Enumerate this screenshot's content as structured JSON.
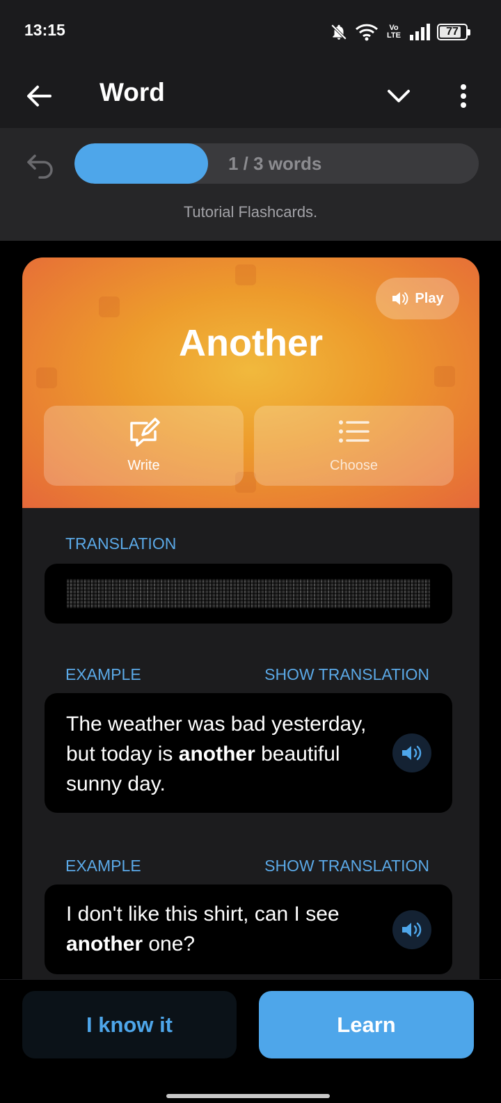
{
  "status": {
    "time": "13:15",
    "network": "Vo LTE",
    "battery": "77"
  },
  "header": {
    "title": "Word"
  },
  "progress": {
    "label": "1 / 3 words",
    "fraction": 0.33
  },
  "deck": {
    "subtitle": "Tutorial Flashcards."
  },
  "card": {
    "word": "Another",
    "play_label": "Play",
    "modes": [
      {
        "label": "Write"
      },
      {
        "label": "Choose"
      }
    ],
    "translation_label": "TRANSLATION",
    "examples": [
      {
        "label": "EXAMPLE",
        "action": "SHOW TRANSLATION",
        "before": "The weather was bad yesterday, but today is ",
        "highlight": "another",
        "after": " beautiful sunny day."
      },
      {
        "label": "EXAMPLE",
        "action": "SHOW TRANSLATION",
        "before": "I don't like this shirt, can I see ",
        "highlight": "another",
        "after": " one?"
      }
    ]
  },
  "actions": {
    "know_label": "I know it",
    "learn_label": "Learn"
  },
  "colors": {
    "accent": "#4ea6ea",
    "hero_center": "#f1b93d",
    "hero_edge": "#e5683a"
  }
}
